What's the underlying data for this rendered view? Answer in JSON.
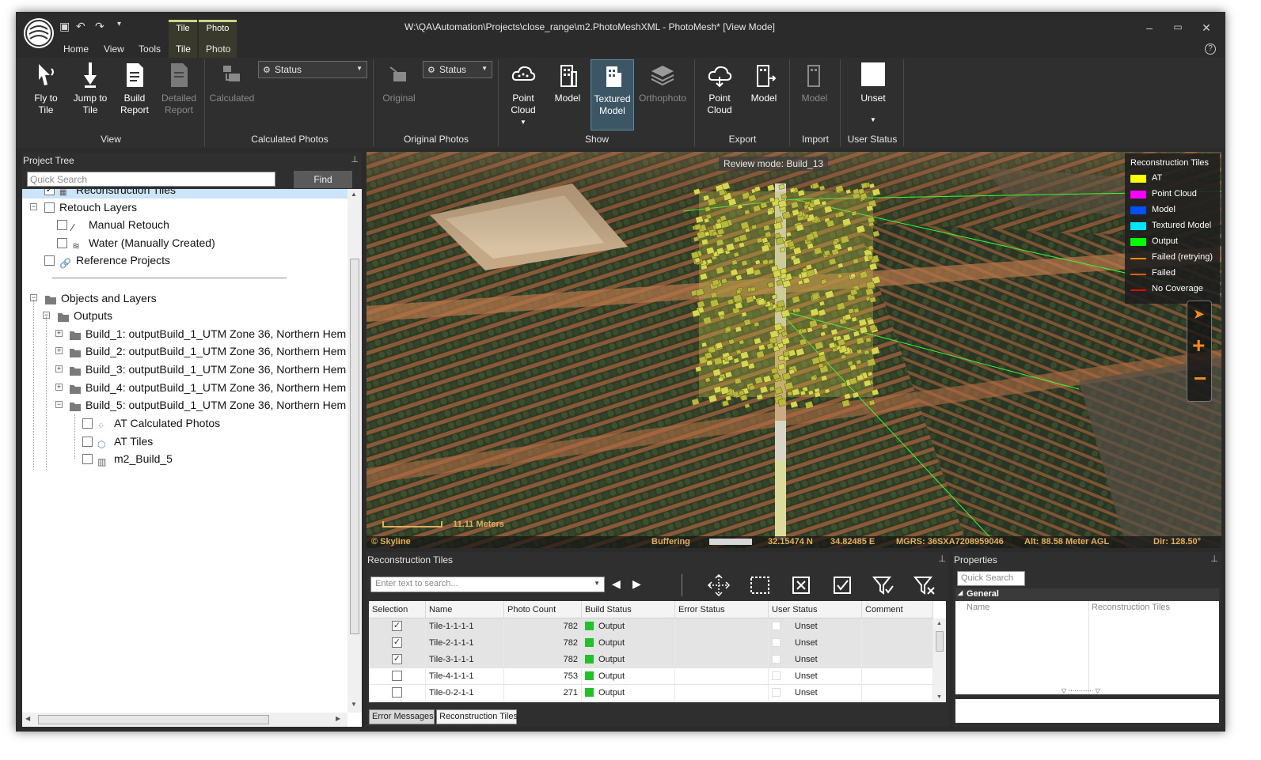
{
  "window": {
    "title": "W:\\QA\\Automation\\Projects\\close_range\\m2.PhotoMeshXML - PhotoMesh* [View Mode]"
  },
  "menu": {
    "home": "Home",
    "view": "View",
    "tools": "Tools",
    "tile": "Tile",
    "photo": "Photo",
    "ctx_tile": "Tile",
    "ctx_photo": "Photo"
  },
  "ribbon": {
    "view_group": {
      "label": "View",
      "fly_to_tile": "Fly to\nTile",
      "jump_to_tile": "Jump to\nTile",
      "build_report": "Build\nReport",
      "detailed_report": "Detailed\nReport"
    },
    "calculated_group": {
      "label": "Calculated Photos",
      "status_dropdown": "Status",
      "calculated": "Calculated"
    },
    "original_group": {
      "label": "Original Photos",
      "status_dropdown": "Status",
      "original": "Original"
    },
    "show_group": {
      "label": "Show",
      "point_cloud": "Point\nCloud",
      "model": "Model",
      "textured_model": "Textured\nModel",
      "orthophoto": "Orthophoto"
    },
    "export_group": {
      "label": "Export",
      "point_cloud": "Point\nCloud",
      "model": "Model"
    },
    "import_group": {
      "label": "Import",
      "model": "Model"
    },
    "user_status_group": {
      "label": "User Status",
      "unset": "Unset"
    }
  },
  "project_tree": {
    "title": "Project Tree",
    "search_placeholder": "Quick Search",
    "find_label": "Find",
    "items": [
      {
        "label": "Reconstruction Tiles",
        "icon": "tiles-icon",
        "checked": true
      },
      {
        "label": "Retouch Layers",
        "icon": "",
        "checked": false
      },
      {
        "label": "Manual Retouch",
        "icon": "brush-icon",
        "checked": false
      },
      {
        "label": "Water (Manually Created)",
        "icon": "water-icon",
        "checked": false
      },
      {
        "label": "Reference Projects",
        "icon": "link-icon",
        "checked": false
      },
      {
        "label": "Objects and Layers",
        "icon": "folder-icon"
      },
      {
        "label": "Outputs",
        "icon": "folder-icon"
      },
      {
        "label": "Build_1: outputBuild_1_UTM Zone 36, Northern Hem",
        "icon": "folder-icon"
      },
      {
        "label": "Build_2: outputBuild_1_UTM Zone 36, Northern Hem",
        "icon": "folder-icon"
      },
      {
        "label": "Build_3: outputBuild_1_UTM Zone 36, Northern Hem",
        "icon": "folder-icon"
      },
      {
        "label": "Build_4: outputBuild_1_UTM Zone 36, Northern Hem",
        "icon": "folder-icon"
      },
      {
        "label": "Build_5: outputBuild_1_UTM Zone 36, Northern Hem",
        "icon": "folder-icon"
      },
      {
        "label": "AT Calculated Photos",
        "icon": "points-icon",
        "checked": false
      },
      {
        "label": "AT Tiles",
        "icon": "cube-icon",
        "checked": false
      },
      {
        "label": "m2_Build_5",
        "icon": "building-icon",
        "checked": false
      }
    ]
  },
  "viewport": {
    "review_mode": "Review mode: Build_13",
    "legend": {
      "title": "Reconstruction Tiles",
      "items": [
        {
          "label": "AT",
          "color": "#ffff00",
          "kind": "fill"
        },
        {
          "label": "Point Cloud",
          "color": "#ff00ff",
          "kind": "fill"
        },
        {
          "label": "Model",
          "color": "#0050ff",
          "kind": "fill"
        },
        {
          "label": "Textured Model",
          "color": "#00e5ff",
          "kind": "fill"
        },
        {
          "label": "Output",
          "color": "#00ff00",
          "kind": "fill"
        },
        {
          "label": "Failed (retrying)",
          "color": "#ff8c00",
          "kind": "line"
        },
        {
          "label": "Failed",
          "color": "#ff5a00",
          "kind": "line"
        },
        {
          "label": "No Coverage",
          "color": "#ff0000",
          "kind": "line"
        }
      ]
    },
    "scale": "11.11 Meters",
    "status": {
      "brand": "© Skyline",
      "buffering": "Buffering",
      "lat": "32.15474 N",
      "lon": "34.82485 E",
      "mgrs": "MGRS: 36SXA7208959046",
      "alt": "Alt: 88.58 Meter AGL",
      "dir": "Dir: 128.50°"
    }
  },
  "tiles_panel": {
    "title": "Reconstruction Tiles",
    "search_placeholder": "Enter text to search...",
    "columns": [
      "Selection",
      "Name",
      "Photo Count",
      "Build Status",
      "Error Status",
      "User Status",
      "Comment"
    ],
    "rows": [
      {
        "selected": true,
        "name": "Tile-1-1-1-1",
        "photo_count": "782",
        "build_status": "Output",
        "error_status": "",
        "user_status": "Unset",
        "comment": ""
      },
      {
        "selected": true,
        "name": "Tile-2-1-1-1",
        "photo_count": "782",
        "build_status": "Output",
        "error_status": "",
        "user_status": "Unset",
        "comment": ""
      },
      {
        "selected": true,
        "name": "Tile-3-1-1-1",
        "photo_count": "782",
        "build_status": "Output",
        "error_status": "",
        "user_status": "Unset",
        "comment": ""
      },
      {
        "selected": false,
        "name": "Tile-4-1-1-1",
        "photo_count": "753",
        "build_status": "Output",
        "error_status": "",
        "user_status": "Unset",
        "comment": ""
      },
      {
        "selected": false,
        "name": "Tile-0-2-1-1",
        "photo_count": "271",
        "build_status": "Output",
        "error_status": "",
        "user_status": "Unset",
        "comment": ""
      }
    ],
    "tabs": [
      "Error Messages",
      "Reconstruction Tiles"
    ]
  },
  "properties_panel": {
    "title": "Properties",
    "search_placeholder": "Quick Search",
    "category": "General",
    "row": {
      "name": "Name",
      "value": "Reconstruction Tiles"
    }
  },
  "colors": {
    "output_status": "#22c02a",
    "ctx_tab_accent": "#c9d68a",
    "active_button": "#3c5665"
  }
}
